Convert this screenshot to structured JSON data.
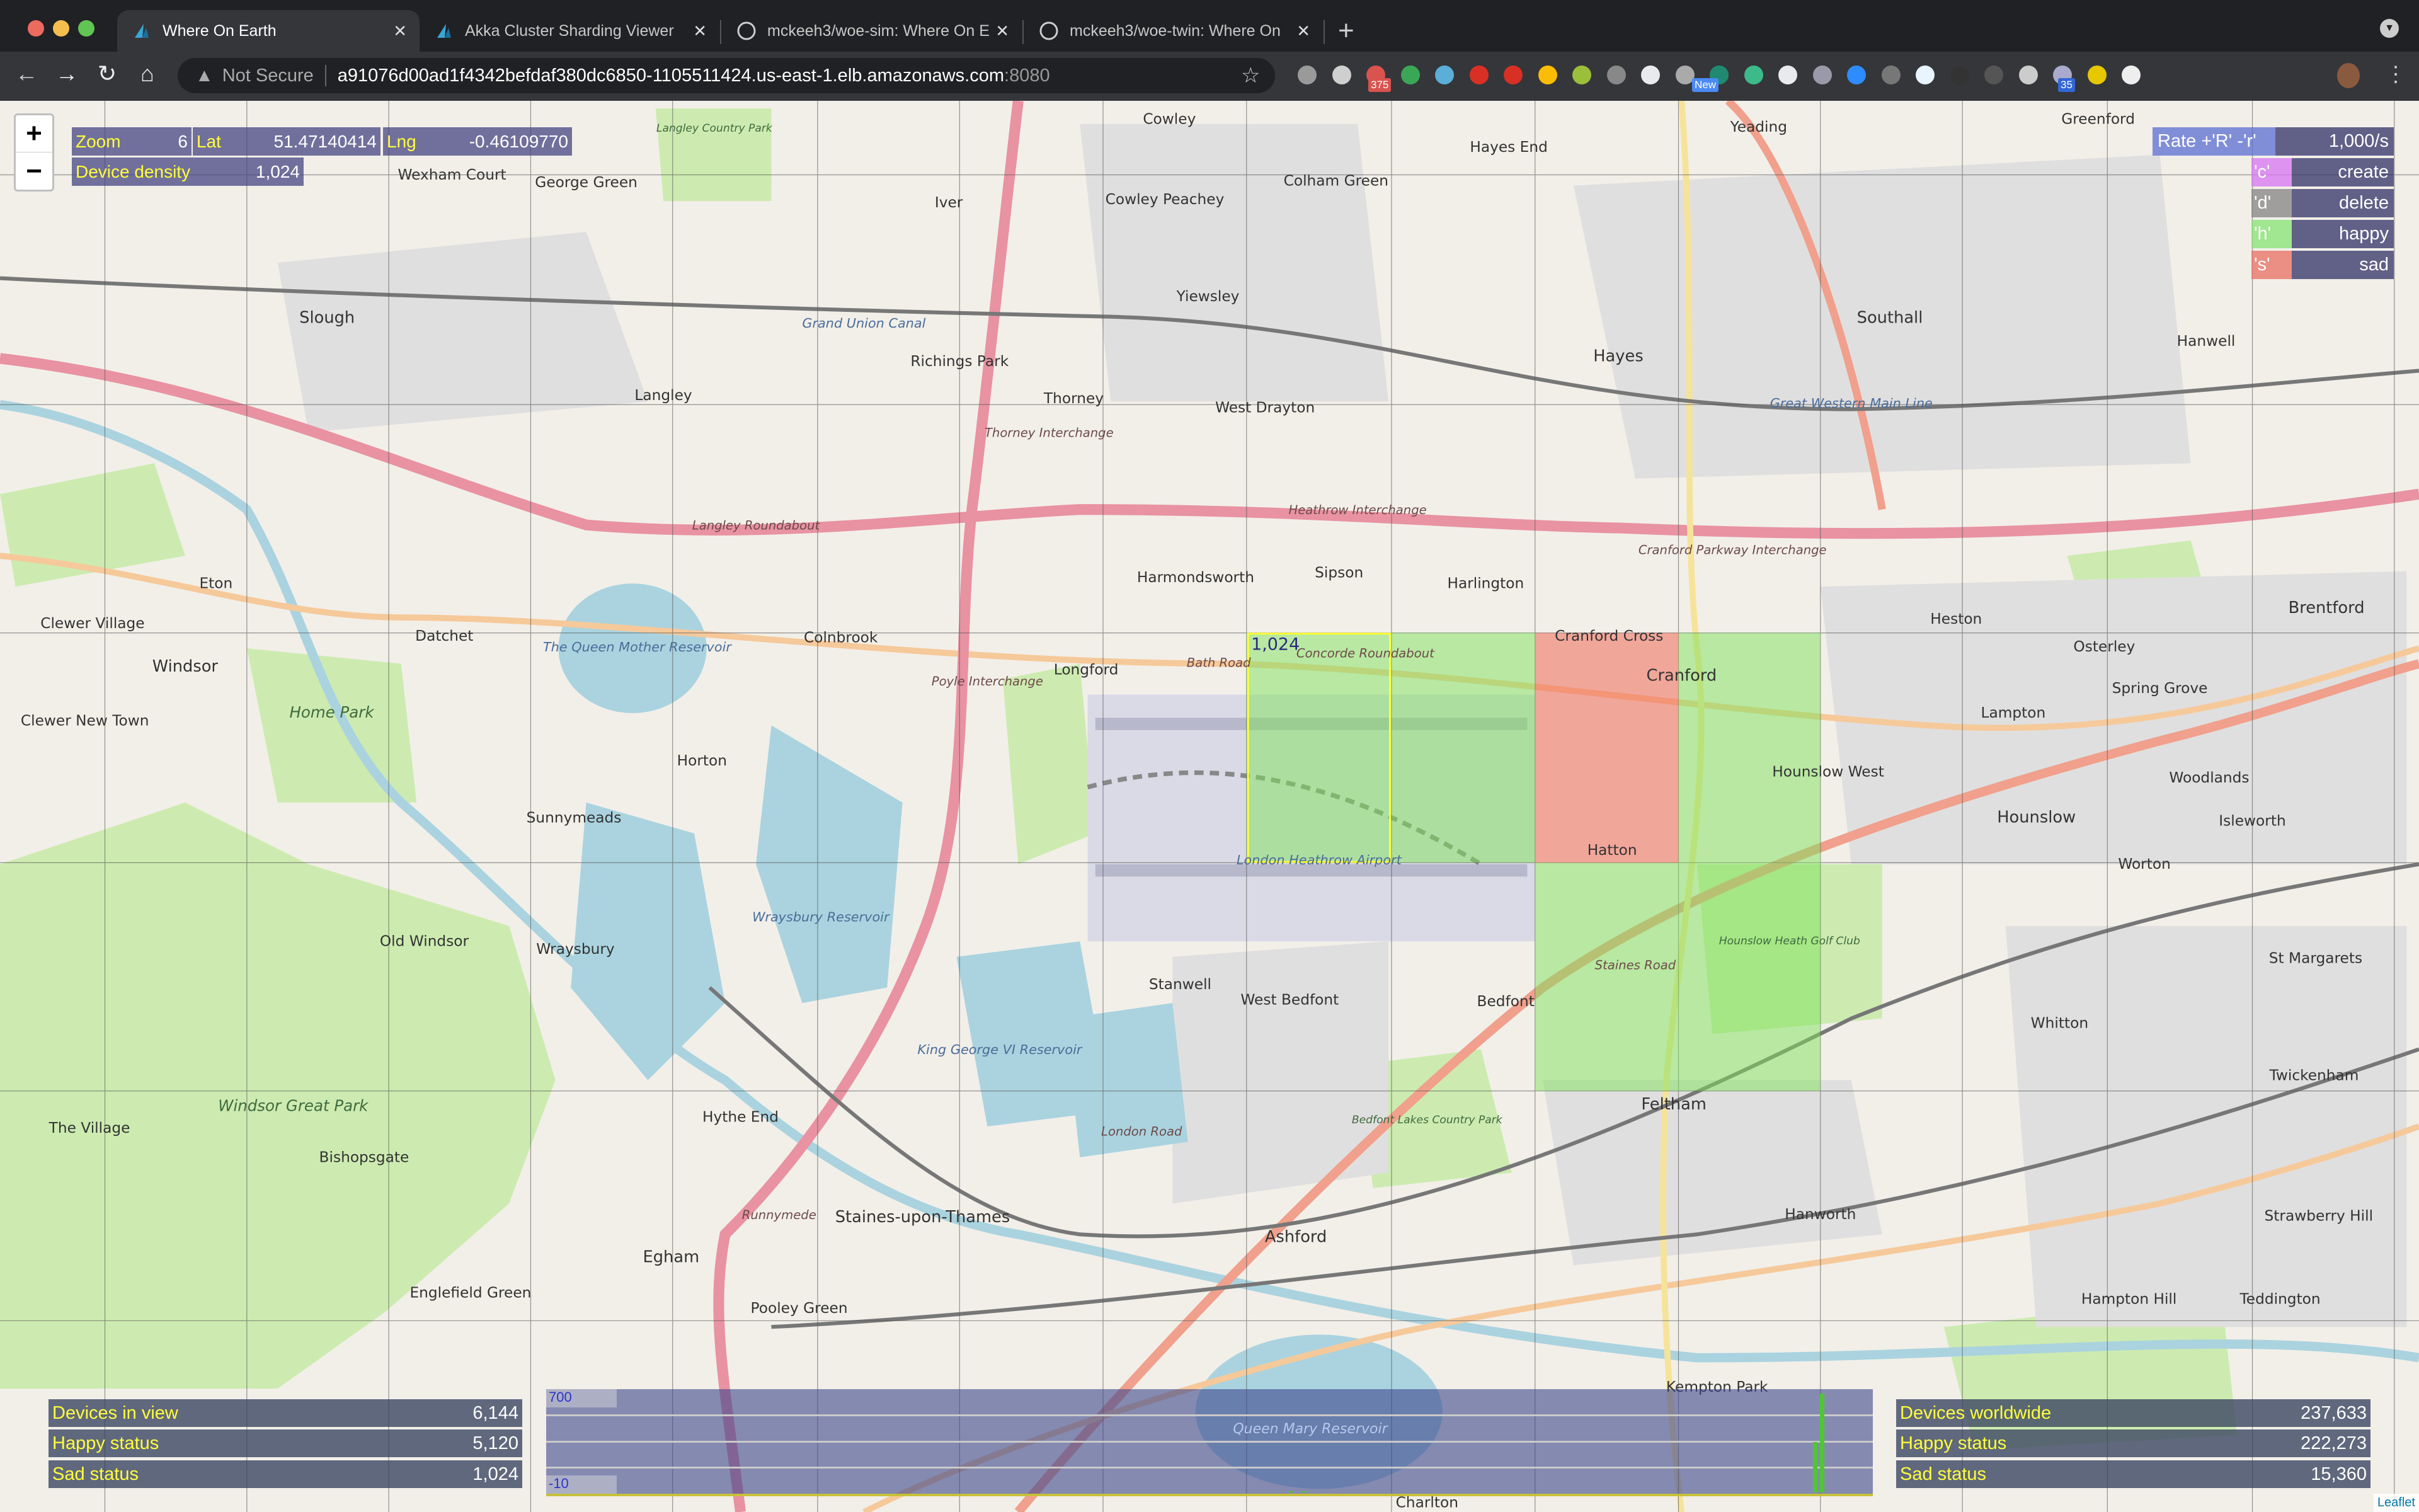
{
  "browser": {
    "tabs": [
      {
        "title": "Where On Earth",
        "icon": "akka-icon",
        "active": true
      },
      {
        "title": "Akka Cluster Sharding Viewer",
        "icon": "akka-icon",
        "active": false
      },
      {
        "title": "mckeeh3/woe-sim: Where On E",
        "icon": "github-icon",
        "active": false
      },
      {
        "title": "mckeeh3/woe-twin: Where On",
        "icon": "github-icon",
        "active": false
      }
    ],
    "security": "Not Secure",
    "url_host": "a91076d00ad1f4342befdaf380dc6850-1105511424.us-east-1.elb.amazonaws.com",
    "url_port": ":8080",
    "extension_badges": {
      "gmail": "375",
      "chrome": "New",
      "counter": "35"
    }
  },
  "controls": {
    "zoom_in": "+",
    "zoom_out": "−"
  },
  "readout": {
    "zoom_label": "Zoom",
    "zoom_value": "6",
    "lat_label": "Lat",
    "lat_value": "51.47140414",
    "lng_label": "Lng",
    "lng_value": "-0.46109770",
    "density_label": "Device density",
    "density_value": "1,024"
  },
  "commands": {
    "rate_label": "Rate +'R' -'r'",
    "rate_value": "1,000/s",
    "rows": [
      {
        "key": "'c'",
        "action": "create",
        "color": "#d77cf0"
      },
      {
        "key": "'d'",
        "action": "delete",
        "color": "#8a8a8a"
      },
      {
        "key": "'h'",
        "action": "happy",
        "color": "#8ce37a"
      },
      {
        "key": "'s'",
        "action": "sad",
        "color": "#e8766a"
      }
    ]
  },
  "grid": {
    "selected_cell_count": "1,024",
    "colors": {
      "happy": "#7ee25a",
      "sad": "#f06a5a",
      "selected": "#ffff33"
    }
  },
  "stats_view": [
    {
      "label": "Devices in view",
      "value": "6,144"
    },
    {
      "label": "Happy status",
      "value": "5,120"
    },
    {
      "label": "Sad status",
      "value": "1,024"
    }
  ],
  "stats_world": [
    {
      "label": "Devices worldwide",
      "value": "237,633"
    },
    {
      "label": "Happy status",
      "value": "222,273"
    },
    {
      "label": "Sad status",
      "value": "15,360"
    }
  ],
  "chart_data": {
    "type": "bar",
    "ylim": [
      -10,
      700
    ],
    "ytick_labels": [
      "700",
      "-10"
    ],
    "samples": 200,
    "nonzero": [
      {
        "i": 112,
        "v": 6
      },
      {
        "i": 114,
        "v": 6
      },
      {
        "i": 191,
        "v": 340
      },
      {
        "i": 192,
        "v": 670
      }
    ],
    "color": "#4ec732"
  },
  "map": {
    "attribution": "Leaflet",
    "labels": [
      "Cowley",
      "Yeading",
      "Hayes End",
      "Greenford",
      "Wexham Court",
      "George Green",
      "Iver",
      "Cowley Peachey",
      "Colham Green",
      "Slough",
      "Richings Park",
      "Yiewsley",
      "Hayes",
      "Southall",
      "Hanwell",
      "Langley",
      "Thorney",
      "West Drayton",
      "Eton",
      "Harmondsworth",
      "Sipson",
      "Harlington",
      "Heston",
      "Osterley",
      "Brentford",
      "Windsor",
      "Datchet",
      "Colnbrook",
      "Longford",
      "Cranford Cross",
      "Cranford",
      "Lampton",
      "Spring Grove",
      "Clewer Village",
      "Clewer New Town",
      "Horton",
      "Hounslow West",
      "Woodlands",
      "Sunnymeads",
      "Hatton",
      "Hounslow",
      "Isleworth",
      "Old Windsor",
      "Wraysbury",
      "Stanwell",
      "West Bedfont",
      "Bedfont",
      "Worton",
      "Whitton",
      "St Margarets",
      "Twickenham",
      "The Village",
      "Bishopsgate",
      "Hythe End",
      "Feltham",
      "Staines-upon-Thames",
      "Egham",
      "Ashford",
      "Hanworth",
      "Strawberry Hill",
      "Teddington",
      "Englefield Green",
      "Pooley Green",
      "Hampton Hill",
      "Kempton Park",
      "Charlton",
      "Windsor Great Park",
      "Home Park",
      "The Queen Mother Reservoir",
      "Wraysbury Reservoir",
      "King George VI Reservoir",
      "Queen Mary Reservoir",
      "London Heathrow Airport",
      "Thorney Interchange",
      "Heathrow Interchange",
      "Poyle Interchange",
      "Langley Roundabout",
      "Concorde Roundabout",
      "Cranford Parkway Interchange",
      "Runnymede",
      "Great Western Main Line",
      "Grand Union Canal",
      "Langley Country Park",
      "Bedfont Lakes Country Park",
      "Hounslow Heath Golf Club",
      "Bath Road",
      "Staines Road",
      "London Road"
    ]
  }
}
